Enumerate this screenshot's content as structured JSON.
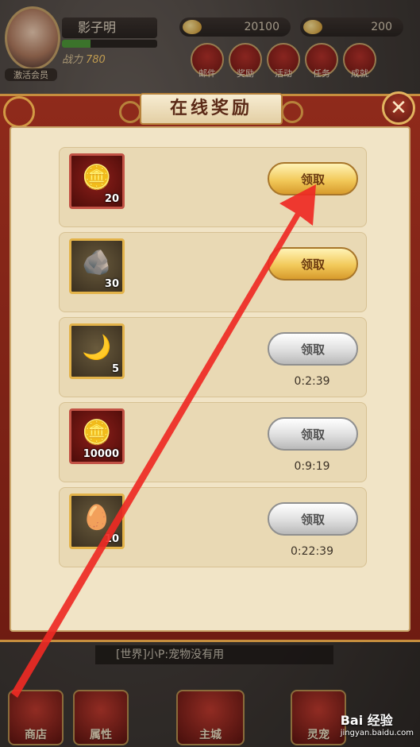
{
  "player": {
    "name": "影子明",
    "vip_label": "激活会员",
    "power_label": "战力",
    "power_value": "780"
  },
  "currencies": [
    {
      "icon": "gold-ingot-icon",
      "value": "20100"
    },
    {
      "icon": "yuanbao-icon",
      "value": "200"
    }
  ],
  "menu": [
    {
      "label": "邮件",
      "icon": "mail-icon"
    },
    {
      "label": "奖励",
      "icon": "reward-icon"
    },
    {
      "label": "活动",
      "icon": "event-icon"
    },
    {
      "label": "任务",
      "icon": "task-icon"
    },
    {
      "label": "成就",
      "icon": "achievement-icon"
    }
  ],
  "dialog": {
    "title": "在线奖励",
    "close_label": "✕",
    "rewards": [
      {
        "icon": "gold-ingot-icon",
        "quantity": "20",
        "button": "领取",
        "state": "active",
        "timer": ""
      },
      {
        "icon": "ore-icon",
        "quantity": "30",
        "button": "领取",
        "state": "active",
        "timer": ""
      },
      {
        "icon": "gold-treasure-icon",
        "quantity": "5",
        "button": "领取",
        "state": "disabled",
        "timer": "0:2:39"
      },
      {
        "icon": "coins-icon",
        "quantity": "10000",
        "button": "领取",
        "state": "disabled",
        "timer": "0:9:19"
      },
      {
        "icon": "egg-icon",
        "quantity": "10",
        "button": "领取",
        "state": "disabled",
        "timer": "0:22:39"
      }
    ]
  },
  "chat": {
    "text": "[世界]小P:宠物没有用"
  },
  "bottom_nav": [
    {
      "label": "商店"
    },
    {
      "label": "属性"
    },
    {
      "label": "主城"
    },
    {
      "label": "灵宠"
    }
  ],
  "watermark": {
    "text": "Bai 经验",
    "url": "jingyan.baidu.com"
  },
  "colors": {
    "dialog_frame": "#8f2a1b",
    "panel": "#f1e4c6",
    "active_button": "#f2c95a",
    "disabled_button": "#dedede",
    "annotation_arrow": "#ee2a24"
  }
}
